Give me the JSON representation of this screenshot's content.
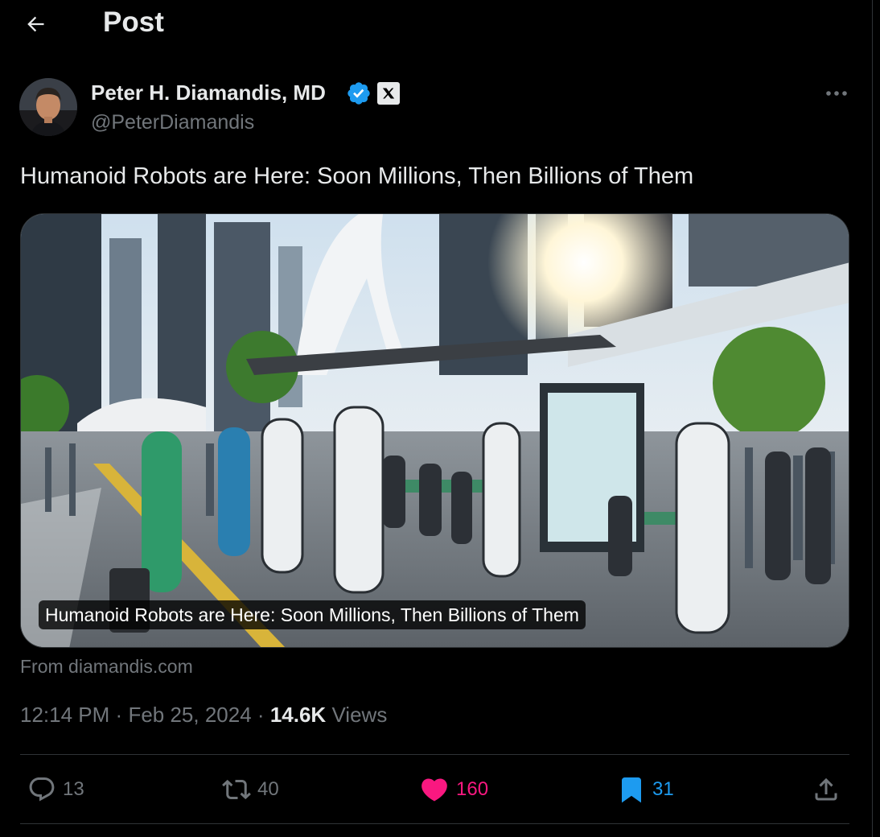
{
  "header": {
    "title": "Post",
    "back_icon": "arrow-left-icon"
  },
  "author": {
    "name": "Peter H. Diamandis, MD",
    "handle": "@PeterDiamandis",
    "verified": true,
    "verified_color": "#1d9bf0",
    "affiliate_badge": "x-logo-icon"
  },
  "post": {
    "text": "Humanoid Robots are Here: Soon Millions, Then Billions of Them",
    "card": {
      "caption": "Humanoid Robots are Here: Soon Millions, Then Billions of Them",
      "source": "From diamandis.com"
    },
    "time": "12:14 PM",
    "date": "Feb 25, 2024",
    "sep": "·",
    "views_count": "14.6K",
    "views_label": "Views"
  },
  "actions": {
    "replies": "13",
    "reposts": "40",
    "likes": "160",
    "bookmarks": "31"
  },
  "colors": {
    "background": "#000000",
    "text_primary": "#e7e9ea",
    "text_secondary": "#71767b",
    "like": "#f91880",
    "bookmark": "#1d9bf0",
    "border": "#2f3336"
  }
}
